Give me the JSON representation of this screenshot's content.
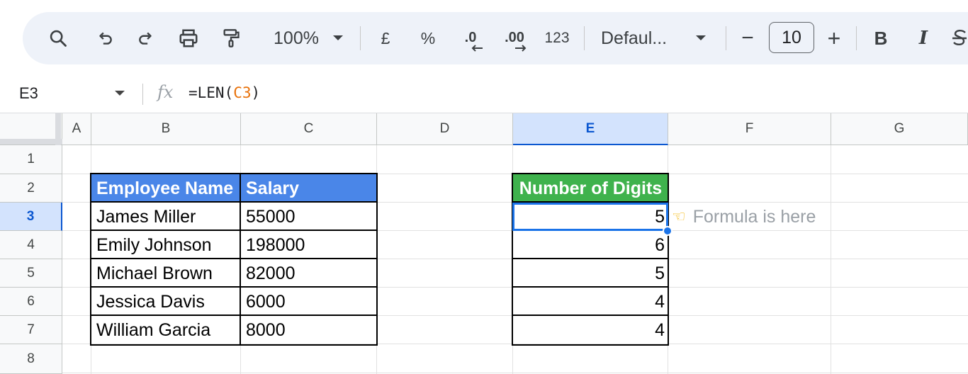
{
  "toolbar": {
    "zoom": "100%",
    "currency": "£",
    "percent": "%",
    "decrease_decimal": ".0",
    "increase_decimal": ".00",
    "number_format": "123",
    "font": "Defaul...",
    "font_size": "10",
    "minus": "−",
    "plus": "+",
    "bold": "B",
    "italic": "I"
  },
  "formula_bar": {
    "cell_ref": "E3",
    "formula_prefix": "=LEN(",
    "formula_ref": "C3",
    "formula_suffix": ")"
  },
  "columns": [
    "A",
    "B",
    "C",
    "D",
    "E",
    "F",
    "G"
  ],
  "rows": [
    "1",
    "2",
    "3",
    "4",
    "5",
    "6",
    "7",
    "8"
  ],
  "table": {
    "headers": [
      "Employee Name",
      "Salary"
    ],
    "rows": [
      [
        "James Miller",
        "55000"
      ],
      [
        "Emily Johnson",
        "198000"
      ],
      [
        "Michael Brown",
        "82000"
      ],
      [
        "Jessica Davis",
        "6000"
      ],
      [
        "William Garcia",
        "8000"
      ]
    ]
  },
  "digits": {
    "header": "Number of Digits",
    "values": [
      "5",
      "6",
      "5",
      "4",
      "4"
    ]
  },
  "note": "Formula is here",
  "note_icon": "pointing-hand-emoji",
  "colors": {
    "header_blue": "#4a86e8",
    "header_green": "#3fb24d",
    "selection": "#1a73e8",
    "active_header_bg": "#d3e3fd"
  }
}
